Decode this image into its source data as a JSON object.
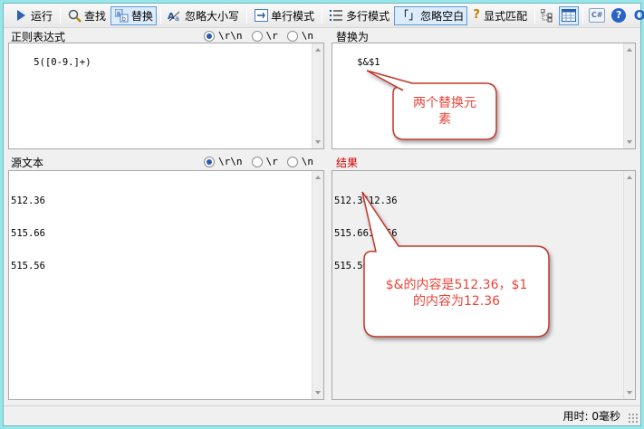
{
  "toolbar": {
    "run": {
      "label": "运行",
      "icon": "play-icon"
    },
    "find": {
      "label": "查找",
      "icon": "magnifier-icon"
    },
    "replace": {
      "label": "替换",
      "icon": "replace-icon"
    },
    "ignore_case": {
      "label": "忽略大小写",
      "icon": "ignore-case-icon"
    },
    "single_line": {
      "label": "单行模式",
      "icon": "single-line-icon"
    },
    "multi_line": {
      "label": "多行模式",
      "icon": "multi-line-icon"
    },
    "ignore_whitespace": {
      "label": "忽略空白",
      "icon": "brackets-icon",
      "glyph": "「」"
    },
    "explicit_capture": {
      "label": "显式匹配",
      "icon": "question-icon",
      "glyph": "?"
    },
    "tree_icon": "tree-view-icon",
    "table_icon": "table-view-icon",
    "csharp_icon": "csharp-icon",
    "csharp_glyph": "C#",
    "help_icon": "help-icon",
    "help_glyph": "?",
    "about_icon": "about-icon",
    "about_glyph": "O"
  },
  "regex_pane": {
    "label": "正则表达式",
    "value": "5([0-9.]+)",
    "options": [
      "\\r\\n",
      "\\r",
      "\\n"
    ],
    "selected": "\\r\\n"
  },
  "replace_pane": {
    "label": "替换为",
    "value": "$&$1"
  },
  "source_pane": {
    "label": "源文本",
    "lines": [
      "512.36",
      "515.66",
      "515.56"
    ],
    "options": [
      "\\r\\n",
      "\\r",
      "\\n"
    ],
    "selected": "\\r\\n"
  },
  "result_pane": {
    "label": "结果",
    "label_color": "#d40000",
    "lines": [
      "512.3612.36",
      "515.6615.66",
      "515.5615.56"
    ]
  },
  "callouts": [
    {
      "lines": [
        "两个替换元",
        "素"
      ]
    },
    {
      "lines": [
        "$&的内容是512.36，$1",
        "的内容为12.36"
      ]
    }
  ],
  "status": {
    "elapsed": "用时: 0毫秒"
  },
  "colors": {
    "callout_text": "#e8443a",
    "callout_border": "#c0392b",
    "window_border": "#98e6ea"
  }
}
